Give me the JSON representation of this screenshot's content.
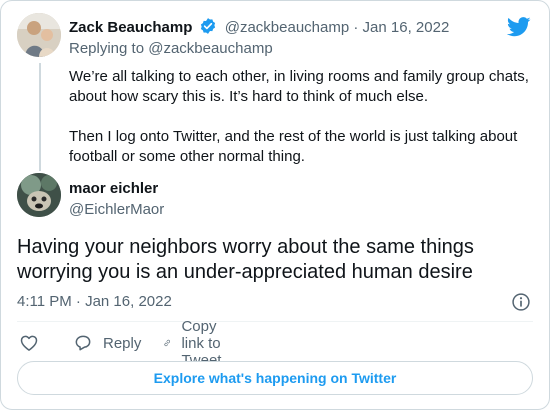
{
  "parent": {
    "name": "Zack Beauchamp",
    "handle": "@zackbeauchamp",
    "date": "Jan 16, 2022",
    "separator": "·",
    "replying_to": "Replying to @zackbeauchamp",
    "text_p1": "We’re all talking to each other, in living rooms and family group chats, about how scary this is. It’s hard to think of much else.",
    "text_p2": "Then I log onto Twitter, and the rest of the world is just talking about football or some other normal thing."
  },
  "main": {
    "name": "maor eichler",
    "handle": "@EichlerMaor",
    "text": "Having your neighbors worry about the same things worrying you is an under-appreciated human desire",
    "timestamp": "4:11 PM · Jan 16, 2022"
  },
  "actions": {
    "reply_label": "Reply",
    "copy_label": "Copy link to Tweet"
  },
  "explore_label": "Explore what's happening on Twitter",
  "colors": {
    "brand": "#1d9bf0",
    "text": "#0f1419",
    "muted": "#536471",
    "border": "#cfd9de"
  },
  "icons": [
    "twitter-bird-icon",
    "verified-badge-icon",
    "info-icon",
    "heart-icon",
    "reply-icon",
    "link-icon"
  ]
}
